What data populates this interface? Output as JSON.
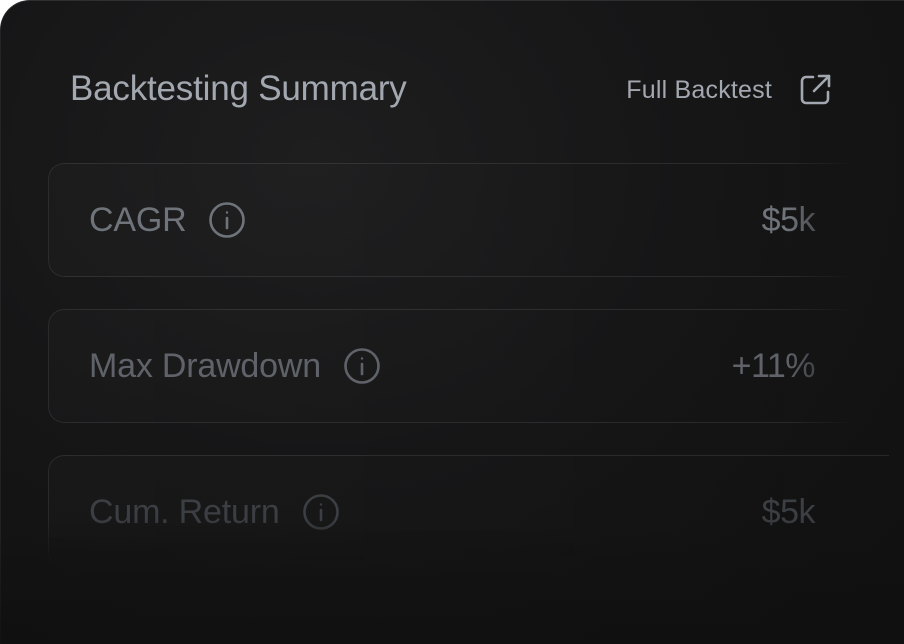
{
  "header": {
    "title": "Backtesting Summary",
    "link_label": "Full Backtest",
    "link_icon": "external-link-icon"
  },
  "metrics": [
    {
      "label": "CAGR",
      "value": "$5k",
      "icon": "info-icon"
    },
    {
      "label": "Max Drawdown",
      "value": "+11%",
      "icon": "info-icon"
    },
    {
      "label": "Cum. Return",
      "value": "$5k",
      "icon": "info-icon"
    }
  ],
  "colors": {
    "background": "#141415",
    "title_text": "#a3a8b0",
    "row_border": "#262628"
  }
}
